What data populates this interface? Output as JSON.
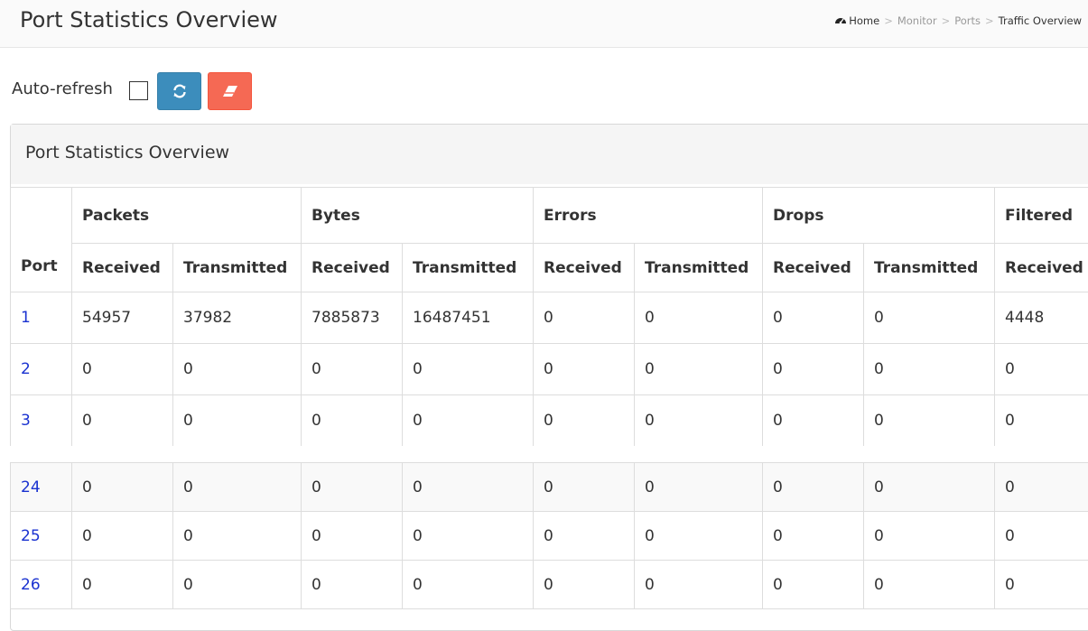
{
  "header": {
    "title": "Port Statistics Overview",
    "breadcrumb": [
      "Home",
      "Monitor",
      "Ports",
      "Traffic Overview"
    ],
    "separator": ">"
  },
  "toolbar": {
    "auto_refresh_label": "Auto-refresh",
    "auto_refresh_checked": false,
    "refresh_icon": "refresh-icon",
    "clear_icon": "eraser-icon"
  },
  "panel": {
    "title": "Port Statistics Overview"
  },
  "table": {
    "port_header": "Port",
    "groups": [
      "Packets",
      "Bytes",
      "Errors",
      "Drops",
      "Filtered"
    ],
    "subheaders": [
      "Received",
      "Transmitted",
      "Received",
      "Transmitted",
      "Received",
      "Transmitted",
      "Received",
      "Transmitted",
      "Received"
    ],
    "rows": [
      {
        "port": "1",
        "values": [
          "54957",
          "37982",
          "7885873",
          "16487451",
          "0",
          "0",
          "0",
          "0",
          "4448"
        ]
      },
      {
        "port": "2",
        "values": [
          "0",
          "0",
          "0",
          "0",
          "0",
          "0",
          "0",
          "0",
          "0"
        ]
      },
      {
        "port": "3",
        "values": [
          "0",
          "0",
          "0",
          "0",
          "0",
          "0",
          "0",
          "0",
          "0"
        ]
      }
    ],
    "rows_after_gap": [
      {
        "port": "24",
        "values": [
          "0",
          "0",
          "0",
          "0",
          "0",
          "0",
          "0",
          "0",
          "0"
        ]
      },
      {
        "port": "25",
        "values": [
          "0",
          "0",
          "0",
          "0",
          "0",
          "0",
          "0",
          "0",
          "0"
        ]
      },
      {
        "port": "26",
        "values": [
          "0",
          "0",
          "0",
          "0",
          "0",
          "0",
          "0",
          "0",
          "0"
        ]
      }
    ]
  },
  "colors": {
    "refresh_button": "#3c8dbc",
    "clear_button": "#f56954",
    "port_link": "#1a32d0"
  }
}
